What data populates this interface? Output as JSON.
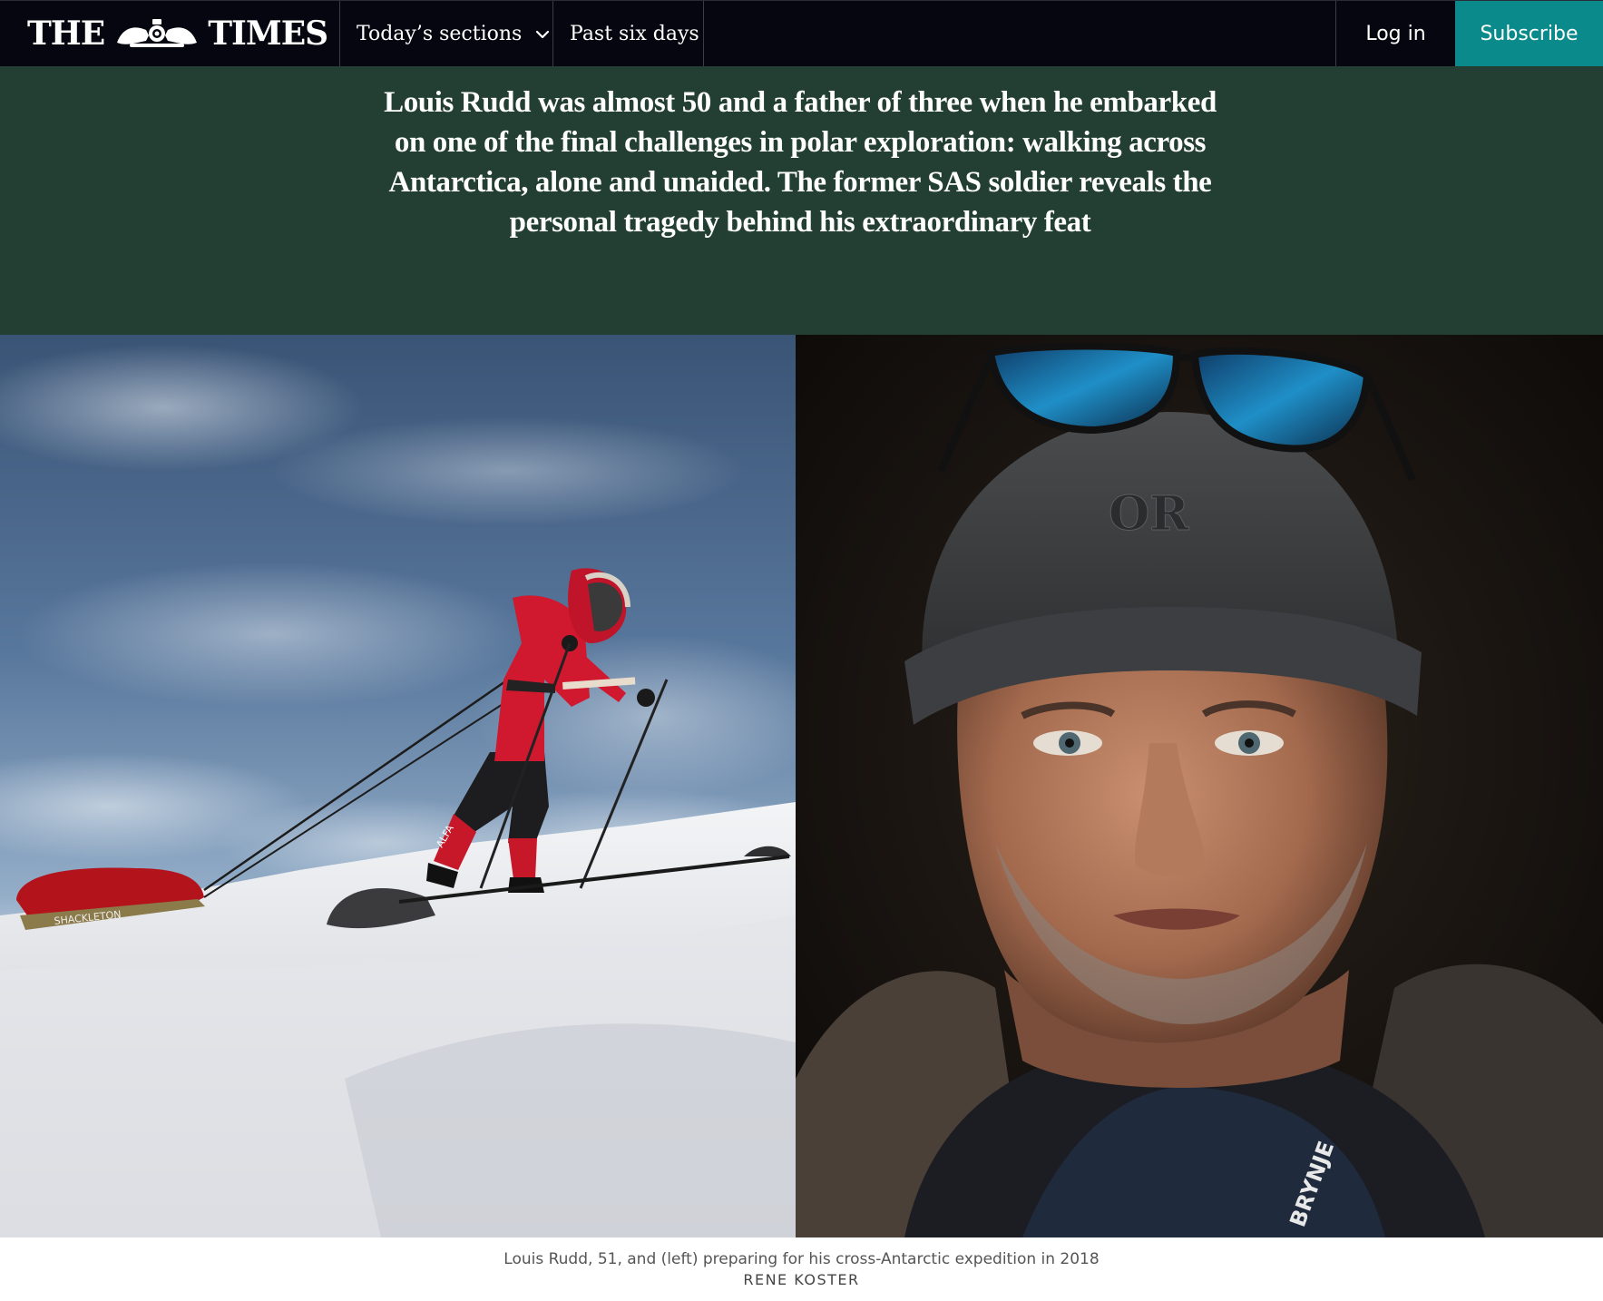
{
  "header": {
    "masthead_left": "THE",
    "masthead_right": "TIMES",
    "crest_icon": "royal-crest-icon",
    "nav": [
      {
        "label": "Today’s sections",
        "icon": "chevron-down-icon"
      },
      {
        "label": "Past six days"
      }
    ],
    "login_label": "Log in",
    "subscribe_label": "Subscribe"
  },
  "article": {
    "standfirst": "Louis Rudd was almost 50 and a father of three when he embarked on one of the final challenges in polar exploration: walking across Antarctica, alone and unaided. The former SAS soldier reveals the personal tragedy behind his extraordinary feat",
    "images": [
      {
        "subject": "skier hauling a sledge across snow under a cloudy sky",
        "sledge_text": "SHACKLETON",
        "gaiter_text": "ALFA"
      },
      {
        "subject": "portrait of Louis Rudd wearing a beanie with sunglasses on top",
        "beanie_logo": "OR",
        "jacket_text": "BRYNJE"
      }
    ],
    "caption": "Louis Rudd, 51, and (left) preparing for his cross-Antarctic expedition in 2018",
    "credit": "RENE KOSTER"
  },
  "colors": {
    "nav_bg": "#05060f",
    "standfirst_bg": "#233f33",
    "subscribe_bg": "#0a8a8a"
  }
}
